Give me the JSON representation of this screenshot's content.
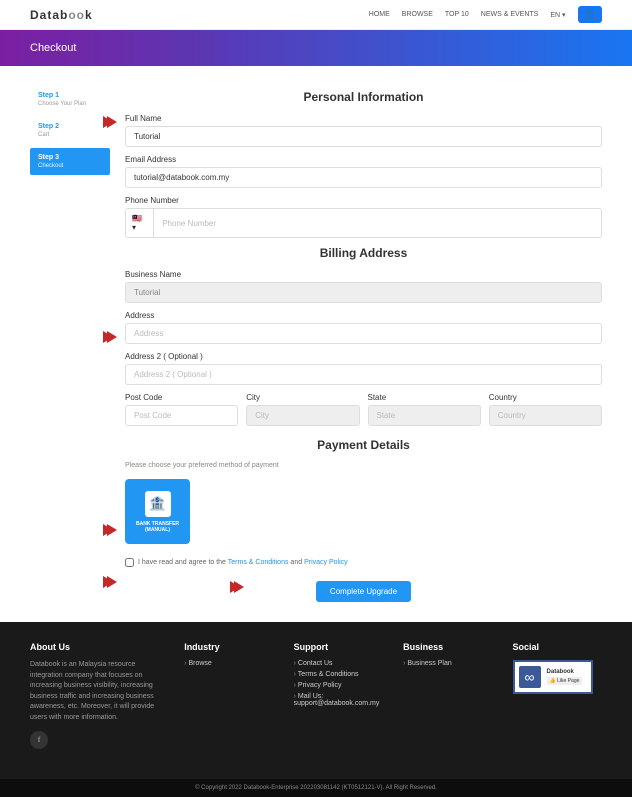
{
  "brand": {
    "name": "Databook"
  },
  "nav": {
    "home": "HOME",
    "browse": "BROWSE",
    "top10": "TOP 10",
    "news": "NEWS & EVENTS",
    "lang": "EN ▾"
  },
  "hero": {
    "title": "Checkout"
  },
  "steps": [
    {
      "title": "Step 1",
      "sub": "Choose Your Plan"
    },
    {
      "title": "Step 2",
      "sub": "Cart"
    },
    {
      "title": "Step 3",
      "sub": "Checkout"
    }
  ],
  "sections": {
    "personal": "Personal Information",
    "billing": "Billing Address",
    "payment": "Payment Details"
  },
  "fields": {
    "fullname": {
      "label": "Full Name",
      "value": "Tutorial"
    },
    "email": {
      "label": "Email Address",
      "value": "tutorial@databook.com.my"
    },
    "phone": {
      "label": "Phone Number",
      "placeholder": "Phone Number",
      "flag": "🇲🇾 ▾"
    },
    "business": {
      "label": "Business Name",
      "value": "Tutorial"
    },
    "address": {
      "label": "Address",
      "placeholder": "Address"
    },
    "address2": {
      "label": "Address 2 ( Optional )",
      "placeholder": "Address 2 ( Optional )"
    },
    "postcode": {
      "label": "Post Code",
      "placeholder": "Post Code"
    },
    "city": {
      "label": "City",
      "placeholder": "City"
    },
    "state": {
      "label": "State",
      "placeholder": "State"
    },
    "country": {
      "label": "Country",
      "placeholder": "Country"
    }
  },
  "payment": {
    "hint": "Please choose your preferred method of payment",
    "opt": "BANK TRANSFER (MANUAL)"
  },
  "agree": {
    "pre": "I have read and agree to the ",
    "tc": "Terms & Conditions",
    "and": " and ",
    "pp": "Privacy Policy"
  },
  "submit": "Complete Upgrade",
  "footer": {
    "about": {
      "h": "About Us",
      "p": "Databook is an Malaysia resource integration company that focuses on increasing business visibility, increasing business traffic and increasing business awareness, etc. Moreover, it will provide users with more information."
    },
    "industry": {
      "h": "Industry",
      "items": [
        "Browse"
      ]
    },
    "support": {
      "h": "Support",
      "items": [
        "Contact Us",
        "Terms & Conditions",
        "Privacy Policy",
        "Mail Us:"
      ],
      "email": "support@databook.com.my"
    },
    "business": {
      "h": "Business",
      "items": [
        "Business Plan"
      ]
    },
    "social": {
      "h": "Social",
      "fbname": "Databook",
      "fblike": "👍 Like Page"
    },
    "copy": "© Copyright 2022 Databook-Enterprise 202203081142 (KT0512121-V). All Right Reserved."
  }
}
